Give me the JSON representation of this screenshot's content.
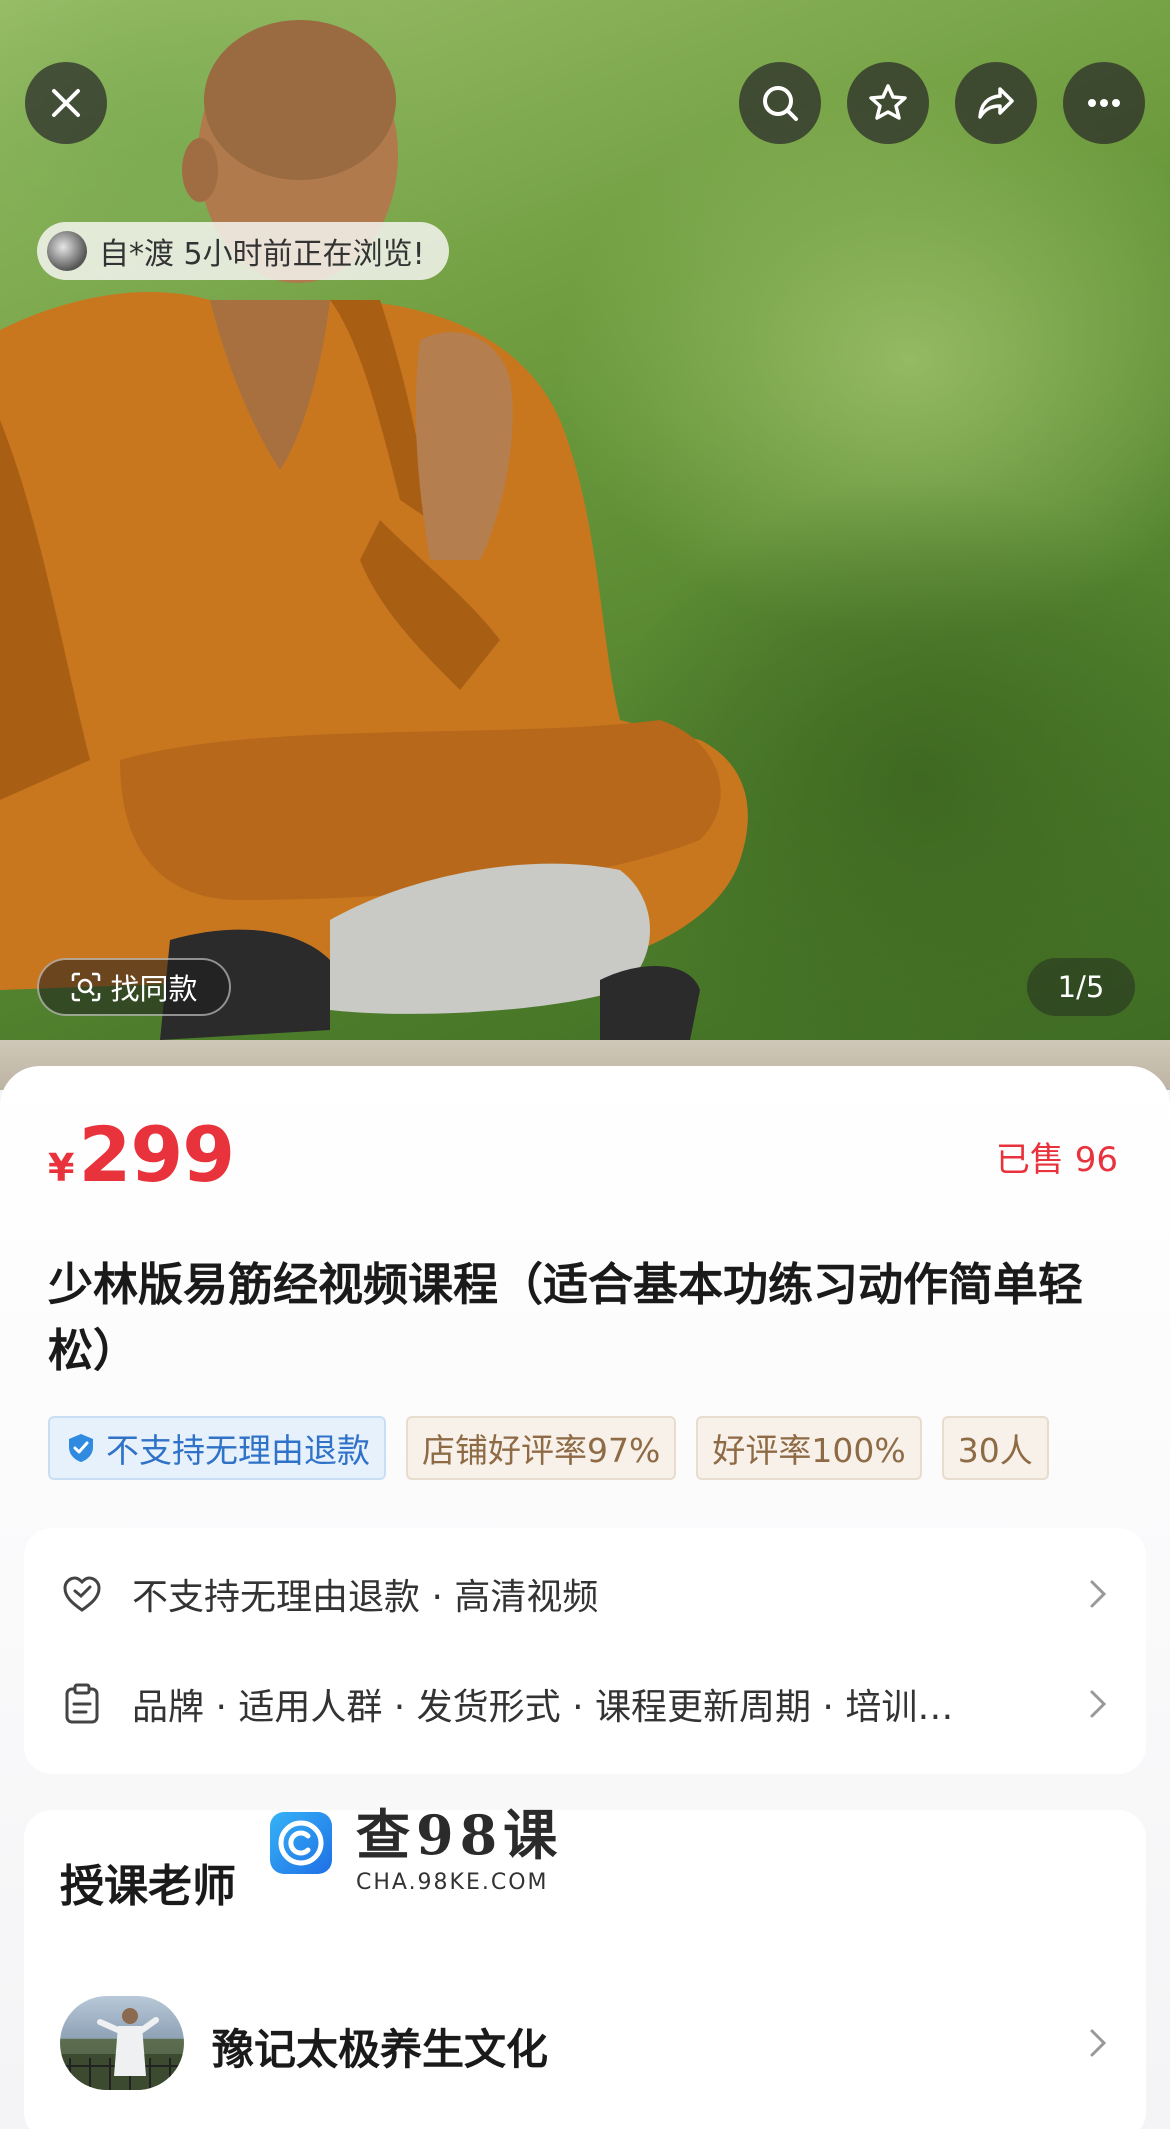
{
  "browse_notice": "自*渡 5小时前正在浏览!",
  "find_same_label": "找同款",
  "image_counter": "1/5",
  "price": {
    "currency": "¥",
    "amount": "299"
  },
  "sold_label": "已售 96",
  "title": "少林版易筋经视频课程（适合基本功练习动作简单轻松）",
  "tags": [
    {
      "text": "不支持无理由退款",
      "style": "blue",
      "icon": "shield-check-icon"
    },
    {
      "text": "店铺好评率97%",
      "style": "tan"
    },
    {
      "text": "好评率100%",
      "style": "tan"
    },
    {
      "text": "30人",
      "style": "tan"
    }
  ],
  "attributes": [
    {
      "text": "不支持无理由退款 · 高清视频",
      "icon": "heart-shield-icon"
    },
    {
      "text": "品牌 · 适用人群 · 发货形式 · 课程更新周期 · 培训…",
      "icon": "clipboard-icon"
    }
  ],
  "teacher_section": {
    "heading": "授课老师",
    "name": "豫记太极养生文化"
  },
  "watermark": {
    "title": "查98课",
    "subtitle": "CHA.98KE.COM"
  },
  "colors": {
    "price_red": "#e8333d",
    "tag_blue": "#2f72c7",
    "tag_tan": "#8e6a45"
  }
}
